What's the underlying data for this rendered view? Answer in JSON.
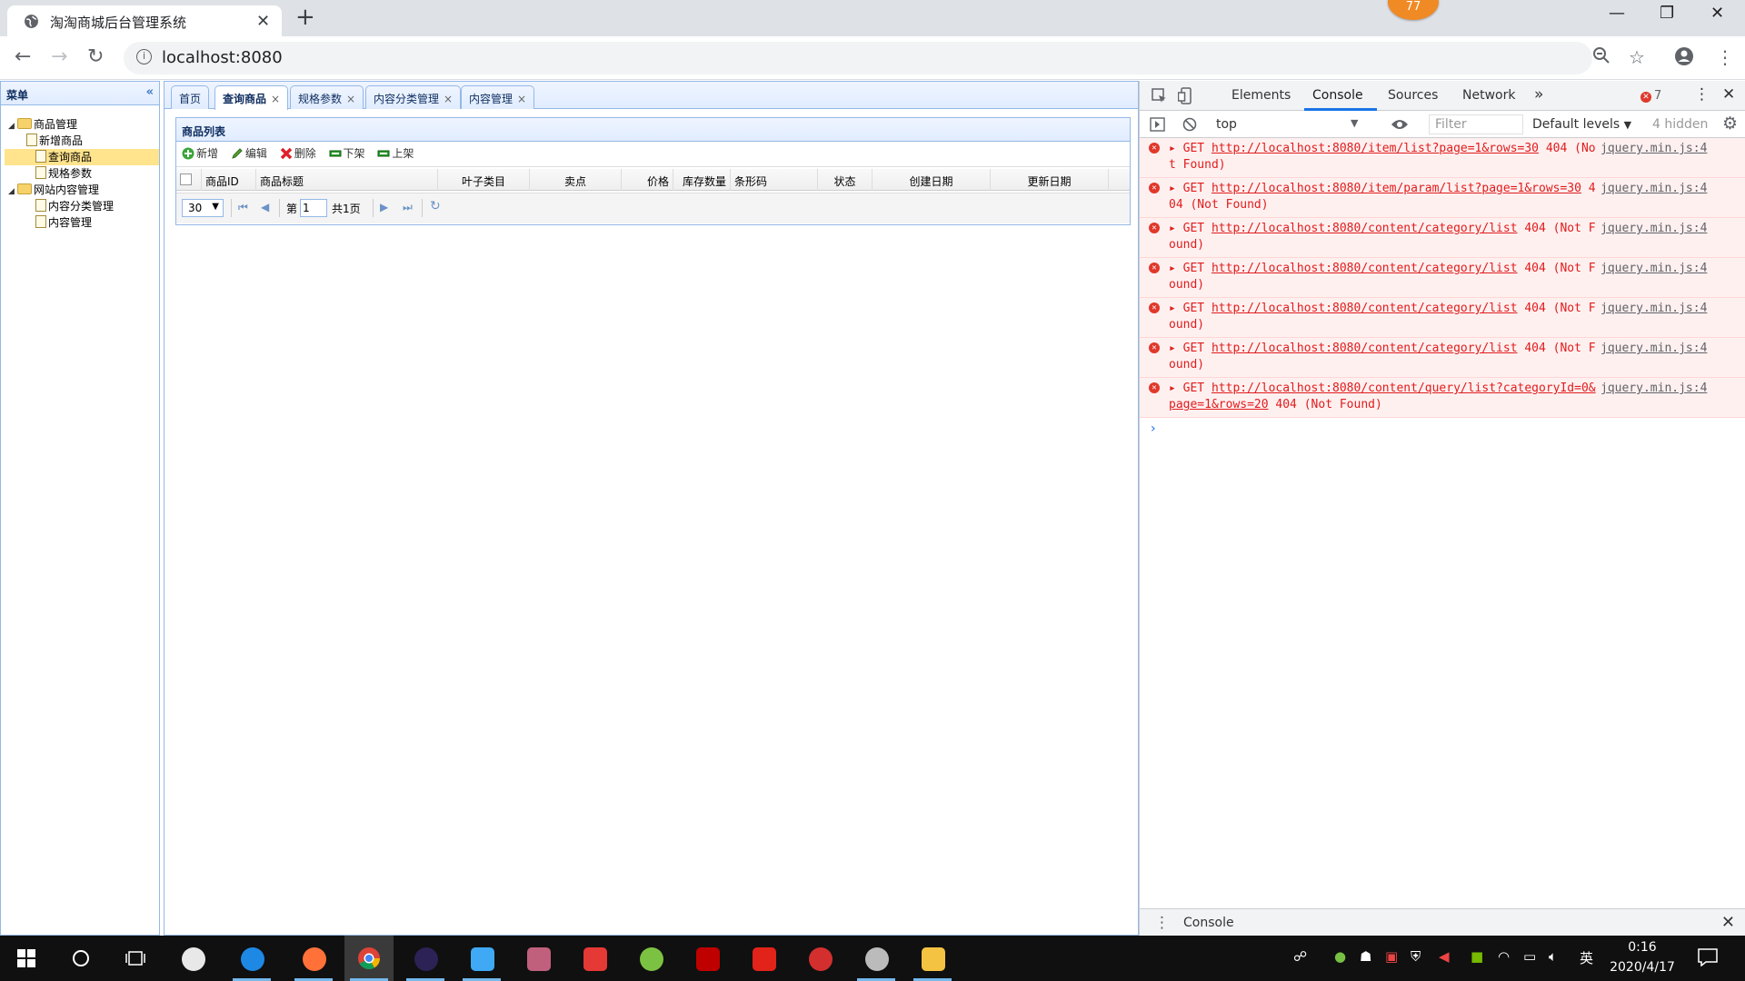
{
  "browser": {
    "tab_title": "淘淘商城后台管理系统",
    "tab_close": "✕",
    "new_tab": "+",
    "url": "localhost:8080",
    "extension_badge": "77",
    "window_min": "—",
    "window_max": "❐",
    "window_close": "✕"
  },
  "menu": {
    "title": "菜单",
    "collapse": "«",
    "tree": [
      {
        "label": "商品管理",
        "type": "folder"
      },
      {
        "label": "新增商品",
        "type": "file"
      },
      {
        "label": "查询商品",
        "type": "file",
        "selected": true
      },
      {
        "label": "规格参数",
        "type": "file"
      },
      {
        "label": "网站内容管理",
        "type": "folder"
      },
      {
        "label": "内容分类管理",
        "type": "file"
      },
      {
        "label": "内容管理",
        "type": "file"
      }
    ]
  },
  "page_tabs": [
    {
      "label": "首页",
      "closable": false
    },
    {
      "label": "查询商品",
      "closable": true,
      "active": true
    },
    {
      "label": "规格参数",
      "closable": true
    },
    {
      "label": "内容分类管理",
      "closable": true
    },
    {
      "label": "内容管理",
      "closable": true
    }
  ],
  "tab_close_glyph": "×",
  "item_list": {
    "title": "商品列表",
    "toolbar": [
      {
        "label": "新增",
        "icon": "add-icon"
      },
      {
        "label": "编辑",
        "icon": "edit-icon"
      },
      {
        "label": "删除",
        "icon": "delete-icon"
      },
      {
        "label": "下架",
        "icon": "offshelf-icon"
      },
      {
        "label": "上架",
        "icon": "onshelf-icon"
      }
    ],
    "columns": [
      "商品ID",
      "商品标题",
      "叶子类目",
      "卖点",
      "价格",
      "库存数量",
      "条形码",
      "状态",
      "创建日期",
      "更新日期"
    ],
    "pager": {
      "page_size": "30",
      "page_prefix": "第",
      "page_value": "1",
      "page_suffix": "共1页"
    }
  },
  "devtools": {
    "tabs": [
      "Elements",
      "Console",
      "Sources",
      "Network"
    ],
    "active_tab": "Console",
    "more": "»",
    "error_count": "7",
    "context": "top",
    "filter_placeholder": "Filter",
    "levels": "Default levels",
    "hidden": "4 hidden",
    "messages": [
      {
        "method": "GET",
        "url": "http://localhost:8080/item/list?page=1&rows=30",
        "status": "404 (Not Found)",
        "source": "jquery.min.js:4"
      },
      {
        "method": "GET",
        "url": "http://localhost:8080/item/param/list?page=1&rows=30",
        "status": "404 (Not Found)",
        "source": "jquery.min.js:4"
      },
      {
        "method": "GET",
        "url": "http://localhost:8080/content/category/list",
        "status": "404 (Not Found)",
        "source": "jquery.min.js:4"
      },
      {
        "method": "GET",
        "url": "http://localhost:8080/content/category/list",
        "status": "404 (Not Found)",
        "source": "jquery.min.js:4"
      },
      {
        "method": "GET",
        "url": "http://localhost:8080/content/category/list",
        "status": "404 (Not Found)",
        "source": "jquery.min.js:4"
      },
      {
        "method": "GET",
        "url": "http://localhost:8080/content/category/list",
        "status": "404 (Not Found)",
        "source": "jquery.min.js:4"
      },
      {
        "method": "GET",
        "url": "http://localhost:8080/content/query/list?categoryId=0&page=1&rows=20",
        "status": "404 (Not Found)",
        "source": "jquery.min.js:4"
      }
    ],
    "prompt": "›",
    "drawer_label": "Console",
    "drawer_close": "✕"
  },
  "taskbar": {
    "apps": [
      {
        "name": "start-button",
        "color": "#ffffff"
      },
      {
        "name": "cortana-search",
        "color": "#ffffff"
      },
      {
        "name": "task-view",
        "color": "#ffffff"
      },
      {
        "name": "pinwheel-app",
        "color": "#e8e8e8"
      },
      {
        "name": "internet-explorer",
        "color": "#1e88e5"
      },
      {
        "name": "firefox",
        "color": "#ff7139"
      },
      {
        "name": "chrome",
        "color": "#4caf50"
      },
      {
        "name": "eclipse",
        "color": "#2c2255"
      },
      {
        "name": "cube-app",
        "color": "#3fa9f5"
      },
      {
        "name": "database-app",
        "color": "#c0607d"
      },
      {
        "name": "hbuilder",
        "color": "#e53935"
      },
      {
        "name": "green-app",
        "color": "#7cc242"
      },
      {
        "name": "filezilla",
        "color": "#bf0000"
      },
      {
        "name": "youdao-dict",
        "color": "#e2231a"
      },
      {
        "name": "snail-app",
        "color": "#d32f2f"
      },
      {
        "name": "settings-gear",
        "color": "#bbbbbb"
      },
      {
        "name": "file-explorer",
        "color": "#f5c342"
      }
    ],
    "ime": "英",
    "time": "0:16",
    "date": "2020/4/17"
  }
}
